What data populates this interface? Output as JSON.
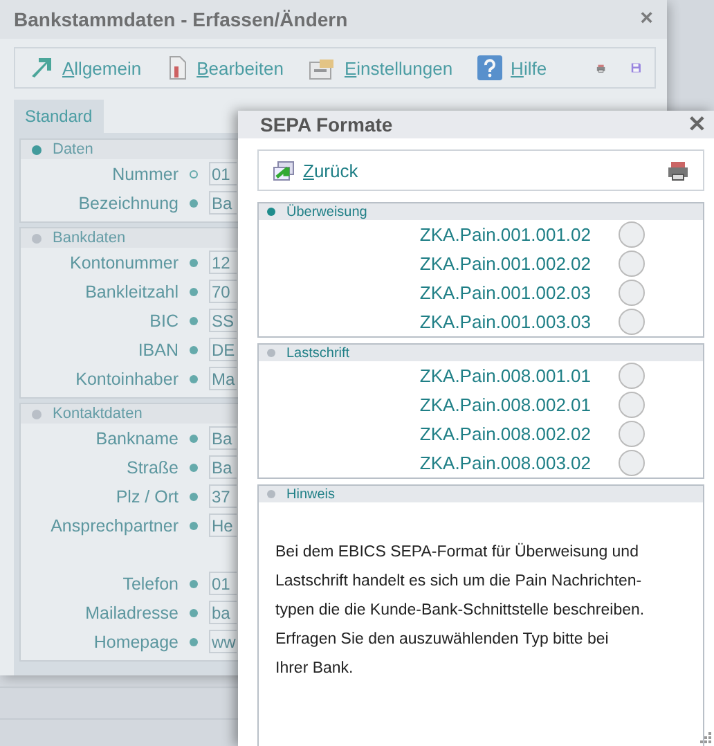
{
  "main_window": {
    "title": "Bankstammdaten - Erfassen/Ändern",
    "close": "×",
    "toolbar": [
      {
        "key": "A",
        "rest": "llgemein"
      },
      {
        "key": "B",
        "rest": "earbeiten"
      },
      {
        "key": "E",
        "rest": "instellungen"
      },
      {
        "key": "H",
        "rest": "ilfe"
      }
    ],
    "tabs": [
      {
        "label": "Standard",
        "selected": true
      }
    ],
    "sections": [
      {
        "title": "Daten",
        "active": true,
        "fields": [
          {
            "label": "Nummer",
            "required": false,
            "value": "01"
          },
          {
            "label": "Bezeichnung",
            "required": true,
            "value": "Ba"
          }
        ]
      },
      {
        "title": "Bankdaten",
        "active": false,
        "fields": [
          {
            "label": "Kontonummer",
            "required": true,
            "value": "12"
          },
          {
            "label": "Bankleitzahl",
            "required": true,
            "value": "70"
          },
          {
            "label": "BIC",
            "required": true,
            "value": "SS"
          },
          {
            "label": "IBAN",
            "required": true,
            "value": "DE"
          },
          {
            "label": "Kontoinhaber",
            "required": true,
            "value": "Ma"
          }
        ]
      },
      {
        "title": "Kontaktdaten",
        "active": false,
        "fields": [
          {
            "label": "Bankname",
            "required": true,
            "value": "Ba"
          },
          {
            "label": "Straße",
            "required": true,
            "value": "Ba"
          },
          {
            "label": "Plz / Ort",
            "required": true,
            "value": "37"
          },
          {
            "label": "Ansprechpartner",
            "required": true,
            "value": "He"
          },
          {
            "kind": "spacer"
          },
          {
            "label": "Telefon",
            "required": true,
            "value": "01"
          },
          {
            "label": "Mailadresse",
            "required": true,
            "value": "ba"
          },
          {
            "label": "Homepage",
            "required": true,
            "value": "ww"
          }
        ]
      }
    ]
  },
  "dialog": {
    "title": "SEPA Formate",
    "close": "✕",
    "back_button": {
      "key": "Z",
      "rest": "urück"
    },
    "groups": [
      {
        "title": "Überweisung",
        "active": true,
        "options": [
          {
            "label": "ZKA.Pain.001.001.02",
            "selected": false
          },
          {
            "label": "ZKA.Pain.001.002.02",
            "selected": false
          },
          {
            "label": "ZKA.Pain.001.002.03",
            "selected": false
          },
          {
            "label": "ZKA.Pain.001.003.03",
            "selected": false
          }
        ]
      },
      {
        "title": "Lastschrift",
        "active": false,
        "options": [
          {
            "label": "ZKA.Pain.008.001.01",
            "selected": false
          },
          {
            "label": "ZKA.Pain.008.002.01",
            "selected": false
          },
          {
            "label": "ZKA.Pain.008.002.02",
            "selected": false
          },
          {
            "label": "ZKA.Pain.008.003.02",
            "selected": false
          }
        ]
      }
    ],
    "note": {
      "title": "Hinweis",
      "active": false,
      "lines": [
        "Bei dem EBICS SEPA-Format für Überweisung und",
        "Lastschrift handelt es sich um die Pain Nachrichten-",
        "typen die die Kunde-Bank-Schnittstelle beschreiben.",
        "Erfragen Sie den auszuwählenden Typ bitte bei",
        "Ihrer Bank."
      ]
    }
  }
}
